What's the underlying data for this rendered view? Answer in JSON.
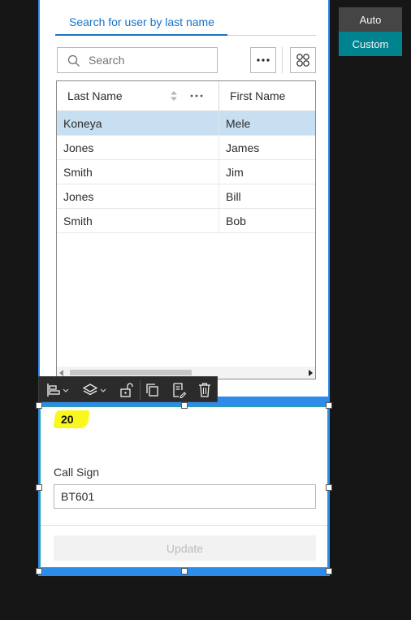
{
  "mode_toggle": {
    "auto_label": "Auto",
    "custom_label": "Custom",
    "active": "Custom"
  },
  "list_widget": {
    "tab_label": "Search for user by last name",
    "search": {
      "placeholder": "Search",
      "value": ""
    },
    "table": {
      "columns": [
        "Last Name",
        "First Name"
      ],
      "rows": [
        {
          "last": "Koneya",
          "first": "Mele",
          "selected": true
        },
        {
          "last": "Jones",
          "first": "James",
          "selected": false
        },
        {
          "last": "Smith",
          "first": "Jim",
          "selected": false
        },
        {
          "last": "Jones",
          "first": "Bill",
          "selected": false
        },
        {
          "last": "Smith",
          "first": "Bob",
          "selected": false
        }
      ]
    }
  },
  "form_widget": {
    "count_value": "20",
    "callsign_label": "Call Sign",
    "callsign_value": "BT601",
    "update_label": "Update"
  },
  "colors": {
    "accent": "#2f8bea",
    "custom_active": "#00838f",
    "selected_row": "#c7dff0",
    "highlight": "#f8f71e"
  }
}
